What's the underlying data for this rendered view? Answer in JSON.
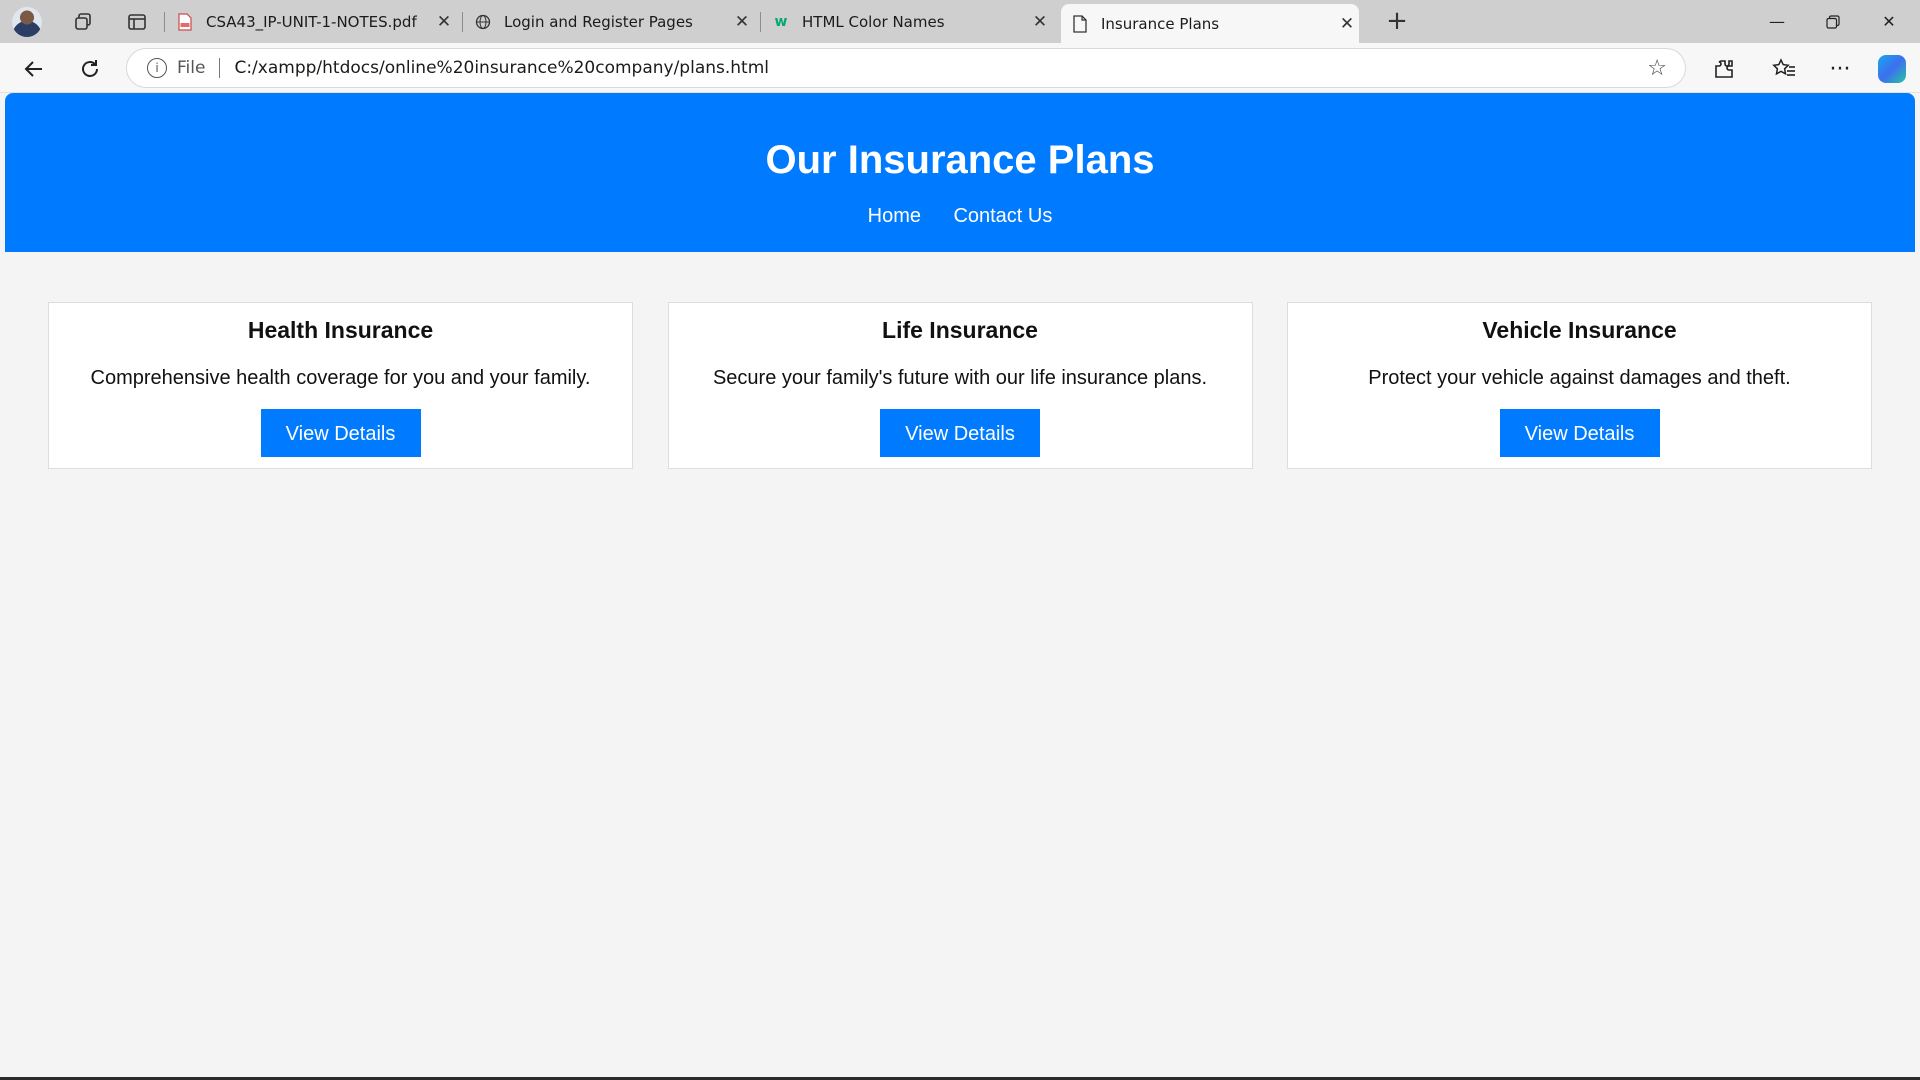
{
  "browser": {
    "tabs": [
      {
        "title": "CSA43_IP-UNIT-1-NOTES.pdf",
        "favicon": "pdf-icon"
      },
      {
        "title": "Login and Register Pages",
        "favicon": "globe-icon"
      },
      {
        "title": "HTML Color Names",
        "favicon": "w3schools-icon"
      },
      {
        "title": "Insurance Plans",
        "favicon": "page-icon",
        "active": true
      }
    ],
    "address": {
      "scheme_label": "File",
      "url": "C:/xampp/htdocs/online%20insurance%20company/plans.html"
    }
  },
  "page": {
    "header_title": "Our Insurance Plans",
    "nav": [
      "Home",
      "Contact Us"
    ],
    "plans": [
      {
        "title": "Health Insurance",
        "description": "Comprehensive health coverage for you and your family.",
        "button": "View Details"
      },
      {
        "title": "Life Insurance",
        "description": "Secure your family's future with our life insurance plans.",
        "button": "View Details"
      },
      {
        "title": "Vehicle Insurance",
        "description": "Protect your vehicle against damages and theft.",
        "button": "View Details"
      }
    ],
    "colors": {
      "primary": "#007bff",
      "background": "#f4f4f4",
      "card": "#ffffff"
    }
  }
}
